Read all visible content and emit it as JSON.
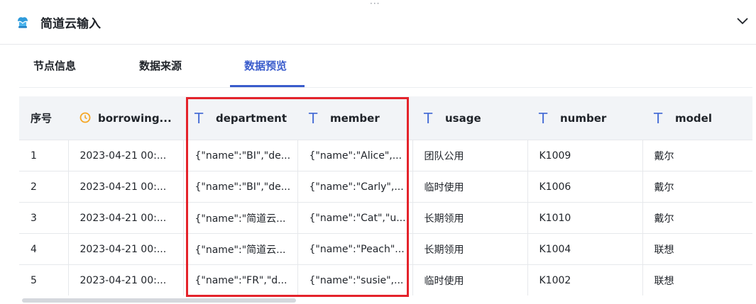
{
  "header": {
    "title": "简道云输入",
    "drag_handle": "···"
  },
  "tabs": [
    {
      "label": "节点信息",
      "active": false
    },
    {
      "label": "数据来源",
      "active": false
    },
    {
      "label": "数据预览",
      "active": true
    }
  ],
  "table": {
    "columns": [
      {
        "label": "序号",
        "icon": "none"
      },
      {
        "label": "borrowing...",
        "icon": "clock-icon"
      },
      {
        "label": "department",
        "icon": "text-type-icon"
      },
      {
        "label": "member",
        "icon": "text-type-icon"
      },
      {
        "label": "usage",
        "icon": "text-type-icon"
      },
      {
        "label": "number",
        "icon": "text-type-icon"
      },
      {
        "label": "model",
        "icon": "text-type-icon"
      }
    ],
    "rows": [
      [
        "1",
        "2023-04-21 00:...",
        "{\"name\":\"BI\",\"de...",
        "{\"name\":\"Alice\",...",
        "团队公用",
        "K1009",
        "戴尔"
      ],
      [
        "2",
        "2023-04-21 00:...",
        "{\"name\":\"BI\",\"de...",
        "{\"name\":\"Carly\",...",
        "临时使用",
        "K1006",
        "戴尔"
      ],
      [
        "3",
        "2023-04-21 00:...",
        "{\"name\":\"简道云...",
        "{\"name\":\"Cat\",\"u...",
        "长期领用",
        "K1010",
        "戴尔"
      ],
      [
        "4",
        "2023-04-21 00:...",
        "{\"name\":\"简道云...",
        "{\"name\":\"Peach\"...",
        "长期领用",
        "K1004",
        "联想"
      ],
      [
        "5",
        "2023-04-21 00:...",
        "{\"name\":\"FR\",\"d...",
        "{\"name\":\"susie\",...",
        "临时使用",
        "K1002",
        "联想"
      ]
    ]
  },
  "colors": {
    "accent": "#3a5ccc",
    "highlight_border": "#e4232b",
    "clock": "#f5a623",
    "type_icon": "#4a6fd6"
  }
}
